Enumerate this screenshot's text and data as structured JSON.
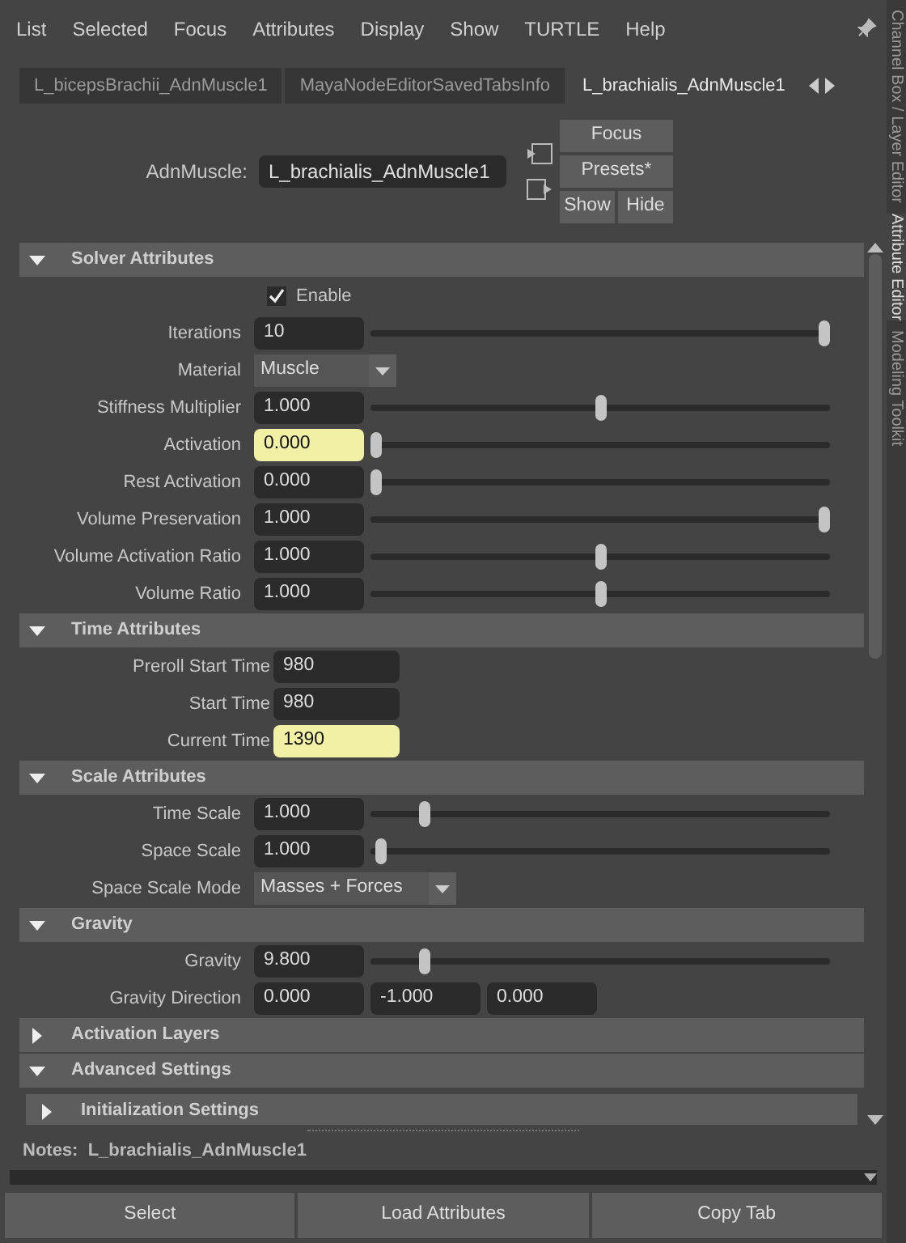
{
  "menu": [
    "List",
    "Selected",
    "Focus",
    "Attributes",
    "Display",
    "Show",
    "TURTLE",
    "Help"
  ],
  "tabs": [
    {
      "label": "L_bicepsBrachii_AdnMuscle1",
      "selected": false
    },
    {
      "label": "MayaNodeEditorSavedTabsInfo",
      "selected": false
    },
    {
      "label": "L_brachialis_AdnMuscle1",
      "selected": true
    }
  ],
  "node": {
    "type_label": "AdnMuscle:",
    "name": "L_brachialis_AdnMuscle1"
  },
  "header_buttons": [
    "Focus",
    "Presets*",
    "Show",
    "Hide"
  ],
  "sections": [
    {
      "title": "Solver Attributes",
      "expanded": true,
      "rows": [
        {
          "kind": "checkbox",
          "label": "Enable",
          "checked": true
        },
        {
          "kind": "slider",
          "label": "Iterations",
          "value": "10",
          "level": 1,
          "keyed": false
        },
        {
          "kind": "dropdown",
          "label": "Material",
          "value": "Muscle"
        },
        {
          "kind": "slider",
          "label": "Stiffness Multiplier",
          "value": "1.000",
          "level": 0.5,
          "keyed": false
        },
        {
          "kind": "slider",
          "label": "Activation",
          "value": "0.000",
          "level": 0,
          "keyed": true
        },
        {
          "kind": "slider",
          "label": "Rest Activation",
          "value": "0.000",
          "level": 0,
          "keyed": false
        },
        {
          "kind": "slider",
          "label": "Volume Preservation",
          "value": "1.000",
          "level": 1,
          "keyed": false
        },
        {
          "kind": "slider",
          "label": "Volume Activation Ratio",
          "value": "1.000",
          "level": 0.5,
          "keyed": false
        },
        {
          "kind": "slider",
          "label": "Volume Ratio",
          "value": "1.000",
          "level": 0.5,
          "keyed": false
        }
      ]
    },
    {
      "title": "Time Attributes",
      "expanded": true,
      "rows": [
        {
          "kind": "field",
          "label": "Preroll Start Time",
          "value": "980",
          "keyed": false
        },
        {
          "kind": "field",
          "label": "Start Time",
          "value": "980",
          "keyed": false
        },
        {
          "kind": "field",
          "label": "Current Time",
          "value": "1390",
          "keyed": true
        }
      ]
    },
    {
      "title": "Scale Attributes",
      "expanded": true,
      "rows": [
        {
          "kind": "slider",
          "label": "Time Scale",
          "value": "1.000",
          "level": 0.11,
          "keyed": false
        },
        {
          "kind": "slider",
          "label": "Space Scale",
          "value": "1.000",
          "level": 0.01,
          "keyed": false
        },
        {
          "kind": "dropdown",
          "label": "Space Scale Mode",
          "value": "Masses + Forces"
        }
      ]
    },
    {
      "title": "Gravity",
      "expanded": true,
      "rows": [
        {
          "kind": "slider",
          "label": "Gravity",
          "value": "9.800",
          "level": 0.11,
          "keyed": false
        },
        {
          "kind": "vector",
          "label": "Gravity Direction",
          "values": [
            "0.000",
            "-1.000",
            "0.000"
          ]
        }
      ]
    },
    {
      "title": "Activation Layers",
      "expanded": false
    },
    {
      "title": "Advanced Settings",
      "expanded": true,
      "subsections": [
        {
          "title": "Initialization Settings",
          "expanded": false
        }
      ]
    }
  ],
  "notes": {
    "label": "Notes:",
    "text": "L_brachialis_AdnMuscle1"
  },
  "bottom_buttons": [
    "Select",
    "Load Attributes",
    "Copy Tab"
  ],
  "side_tabs": [
    {
      "label": "Channel Box / Layer Editor",
      "selected": false
    },
    {
      "label": "Attribute Editor",
      "selected": true
    },
    {
      "label": "Modeling Toolkit",
      "selected": false
    }
  ]
}
